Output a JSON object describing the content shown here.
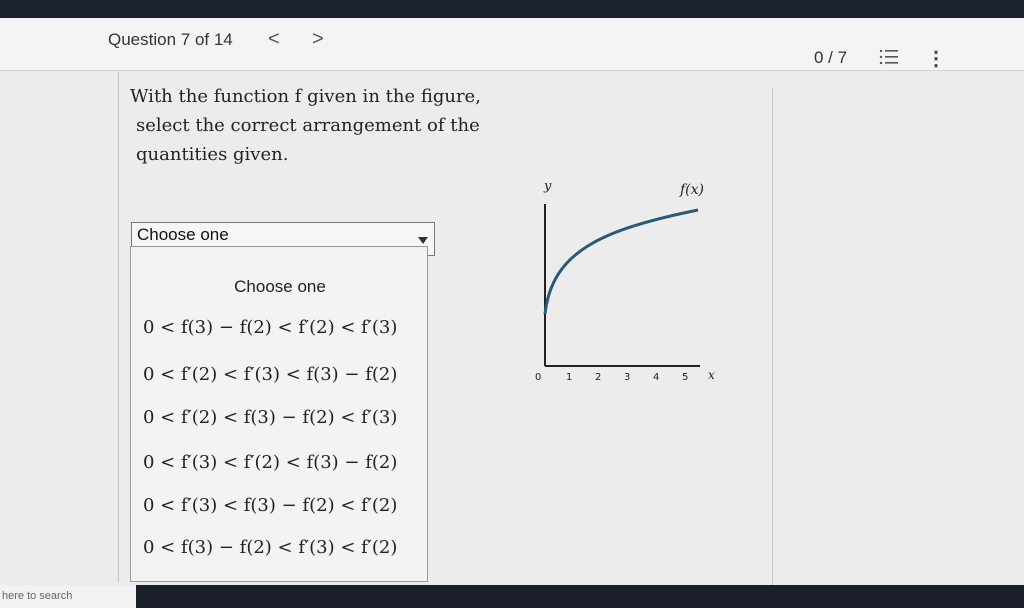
{
  "header": {
    "question_label": "Question 7 of 14",
    "prev_symbol": "<",
    "next_symbol": ">",
    "score": "0 / 7",
    "more_symbol": "⋮"
  },
  "prompt": {
    "line1": "With the function f given in the figure,",
    "line2": "select the correct arrangement of the",
    "line3": "quantities given."
  },
  "select": {
    "value": "Choose one"
  },
  "dropdown": {
    "options": [
      "Choose one",
      "0 < f(3) − f(2) < f′(2) < f′(3)",
      "0 < f′(2) < f′(3) < f(3) − f(2)",
      "0 < f′(2) < f(3) − f(2) < f′(3)",
      "0 < f′(3) < f′(2) < f(3) − f(2)",
      "0 < f′(3) < f(3) − f(2) < f′(2)",
      "0 < f(3) − f(2) < f′(3) < f′(2)"
    ]
  },
  "graph": {
    "y_label": "y",
    "x_label": "x",
    "curve_label": "f(x)",
    "ticks": [
      "0",
      "1",
      "2",
      "3",
      "4",
      "5"
    ],
    "curve_color": "#2a5a78"
  },
  "taskbar": {
    "search_text": "here to search"
  }
}
